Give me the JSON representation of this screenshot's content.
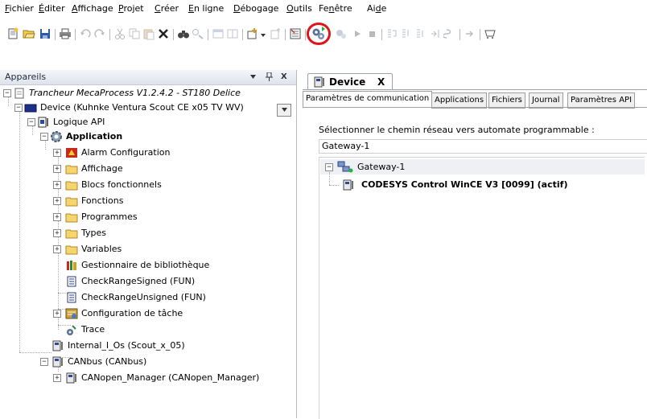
{
  "menubar": {
    "items": [
      {
        "label": "Fichier",
        "mnemonic": "F",
        "rest": "ichier"
      },
      {
        "label": "Éditer",
        "mnemonic": "É",
        "rest": "diter"
      },
      {
        "label": "Affichage",
        "mnemonic": "A",
        "rest": "ffichage"
      },
      {
        "label": "Projet",
        "mnemonic": "P",
        "rest": "rojet"
      },
      {
        "label": "Créer",
        "mnemonic": "C",
        "rest": "réer"
      },
      {
        "label": "En ligne",
        "mnemonic": "E",
        "rest": "n ligne"
      },
      {
        "label": "Débogage",
        "mnemonic": "D",
        "rest": "ébogage"
      },
      {
        "label": "Outils",
        "mnemonic": "O",
        "rest": "utils"
      },
      {
        "label": "Fenêtre",
        "pre": "Fe",
        "mnemonic": "n",
        "rest": "être"
      },
      {
        "label": "Aide",
        "pre": "Ai",
        "mnemonic": "d",
        "rest": "e"
      }
    ]
  },
  "toolbar": {
    "icons": [
      "new-project-icon",
      "open-project-icon",
      "save-project-icon",
      "print-icon",
      "undo-icon",
      "redo-icon",
      "cut-icon",
      "copy-icon",
      "paste-icon",
      "delete-icon",
      "find-icon",
      "replace-icon",
      "properties-icon",
      "window-icon",
      "add-object-icon",
      "insert-icon",
      "build-icon",
      "login-icon",
      "logout-icon",
      "start-icon",
      "stop-icon",
      "step-over-icon",
      "step-into-icon",
      "step-out-icon",
      "run-to-cursor-icon",
      "cycle-icon",
      "breakpoint-icon",
      "toolbox-icon"
    ],
    "highlight_color": "#e0141b"
  },
  "devices_pane": {
    "title": "Appareils",
    "pin_icon": "pin-icon",
    "close_label": "X",
    "tree": [
      {
        "label": "Trancheur MecaProcess V1.2.4.2 - ST180 Delice",
        "icon": "project-icon",
        "italic": true
      },
      {
        "label": "Device (Kuhnke Ventura Scout CE x05 TV WV)",
        "icon": "device-icon"
      },
      {
        "label": "Logique API",
        "icon": "plc-logic-icon"
      },
      {
        "label": "Application",
        "icon": "application-icon",
        "bold": true
      },
      {
        "label": "Alarm Configuration",
        "icon": "alarm-icon"
      },
      {
        "label": "Affichage",
        "icon": "folder-icon"
      },
      {
        "label": "Blocs fonctionnels",
        "icon": "folder-icon"
      },
      {
        "label": "Fonctions",
        "icon": "folder-icon"
      },
      {
        "label": "Programmes",
        "icon": "folder-icon"
      },
      {
        "label": "Types",
        "icon": "folder-icon"
      },
      {
        "label": "Variables",
        "icon": "folder-icon"
      },
      {
        "label": "Gestionnaire de bibliothèque",
        "icon": "library-icon"
      },
      {
        "label": "CheckRangeSigned (FUN)",
        "icon": "pou-icon"
      },
      {
        "label": "CheckRangeUnsigned (FUN)",
        "icon": "pou-icon"
      },
      {
        "label": "Configuration de tâche",
        "icon": "task-config-icon"
      },
      {
        "label": "Trace",
        "icon": "trace-icon"
      },
      {
        "label": "Internal_I_Os (Scout_x_05)",
        "icon": "io-module-icon"
      },
      {
        "label": "CANbus (CANbus)",
        "icon": "io-module-icon"
      },
      {
        "label": "CANopen_Manager (CANopen_Manager)",
        "icon": "io-module-icon"
      }
    ]
  },
  "editor": {
    "tab_label": "Device",
    "tab_close": "X",
    "sub_tabs": [
      "Paramètres de communication",
      "Applications",
      "Fichiers",
      "Journal",
      "Paramètres API"
    ],
    "path_label": "Sélectionner le chemin réseau vers automate programmable :",
    "path_value": "Gateway-1",
    "gateway_label": "Gateway-1",
    "device_label": "CODESYS Control WinCE V3 [0099] (actif)"
  }
}
